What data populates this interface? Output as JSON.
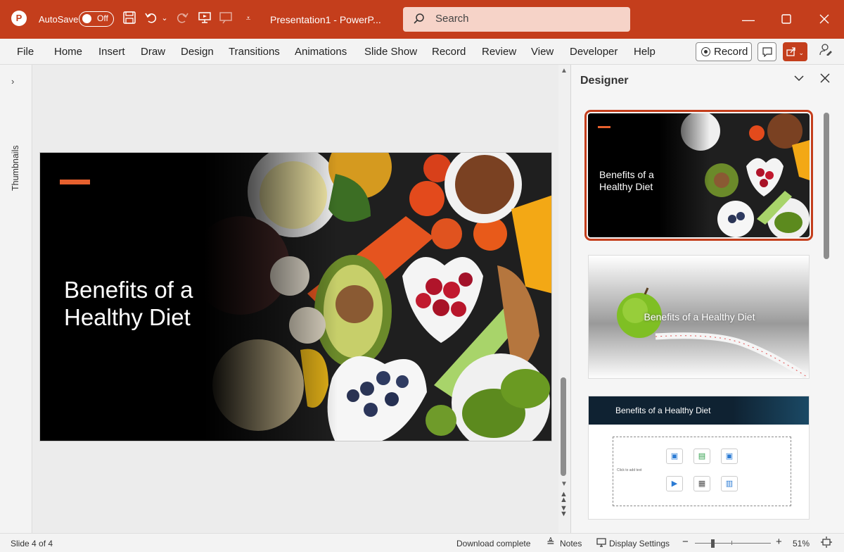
{
  "titlebar": {
    "app_logo": "P",
    "autosave_label": "AutoSave",
    "autosave_state": "Off",
    "doc_title": "Presentation1  -  PowerP...",
    "search_placeholder": "Search",
    "icons": [
      "save-icon",
      "undo-icon",
      "redo-icon",
      "present-from-beginning-icon",
      "present-icon",
      "customize-quick-access-icon",
      "minimize-icon",
      "maximize-icon",
      "close-icon"
    ]
  },
  "ribbon": {
    "tabs": [
      "File",
      "Home",
      "Insert",
      "Draw",
      "Design",
      "Transitions",
      "Animations",
      "Slide Show",
      "Record",
      "Review",
      "View",
      "Developer",
      "Help"
    ],
    "record_label": "Record"
  },
  "thumbnails": {
    "label": "Thumbnails"
  },
  "slide": {
    "title": "Benefits of a Healthy Diet"
  },
  "designer": {
    "title": "Designer",
    "cards": [
      {
        "title": "Benefits of a Healthy Diet",
        "selected": true
      },
      {
        "title": "Benefits of a Healthy Diet",
        "selected": false
      },
      {
        "title": "Benefits of a Healthy Diet",
        "body_placeholder": "Click to add text",
        "selected": false
      }
    ]
  },
  "statusbar": {
    "slide_info": "Slide 4 of 4",
    "download_status": "Download complete",
    "notes_label": "Notes",
    "display_settings_label": "Display Settings",
    "zoom_minus": "−",
    "zoom_plus": "+",
    "zoom_level": "51%"
  },
  "colors": {
    "brand": "#c43e1c",
    "accent": "#e6602e",
    "search_bg": "#f6d3c8"
  }
}
